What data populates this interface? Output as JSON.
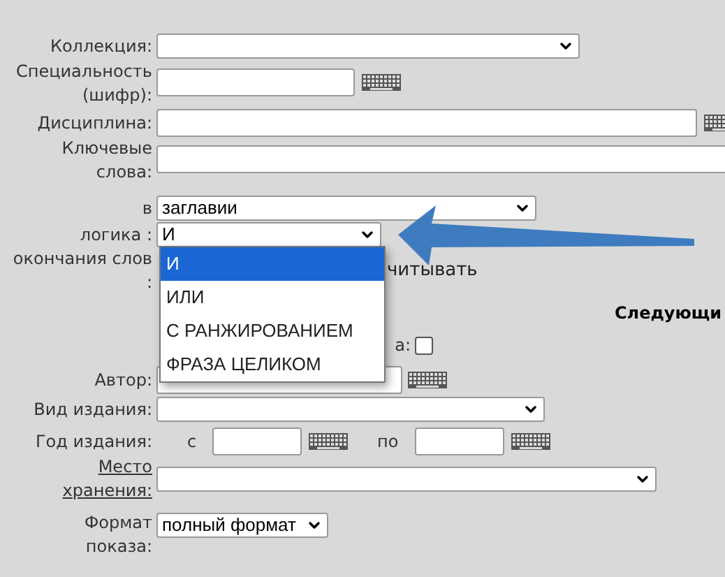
{
  "collection": {
    "label": "Коллекция:"
  },
  "specialty": {
    "label": "Специальность (шифр):"
  },
  "discipline": {
    "label": "Дисциплина:"
  },
  "keywords": {
    "label": "Ключевые слова:"
  },
  "search_in": {
    "label": "в",
    "value": "заглавии"
  },
  "logic": {
    "label": "логика :",
    "value": "И",
    "expanded": true,
    "options": [
      {
        "label": "И",
        "selected": true
      },
      {
        "label": "ИЛИ",
        "selected": false
      },
      {
        "label": "С РАНЖИРОВАНИЕМ",
        "selected": false
      },
      {
        "label": "ФРАЗА ЦЕЛИКОМ",
        "selected": false
      }
    ]
  },
  "word_endings": {
    "label": "окончания слов :",
    "option_text": "читывать"
  },
  "next_heading": "Следующи",
  "hidden_checkbox": {
    "label": "а:",
    "checked": false
  },
  "author": {
    "label": "Автор:"
  },
  "publication_type": {
    "label": "Вид издания:"
  },
  "year": {
    "label": "Год издания:",
    "from_label": "с",
    "to_label": "по"
  },
  "storage": {
    "label": "Место хранения:"
  },
  "display_format": {
    "label": "Формат показа:",
    "value": "полный формат"
  }
}
